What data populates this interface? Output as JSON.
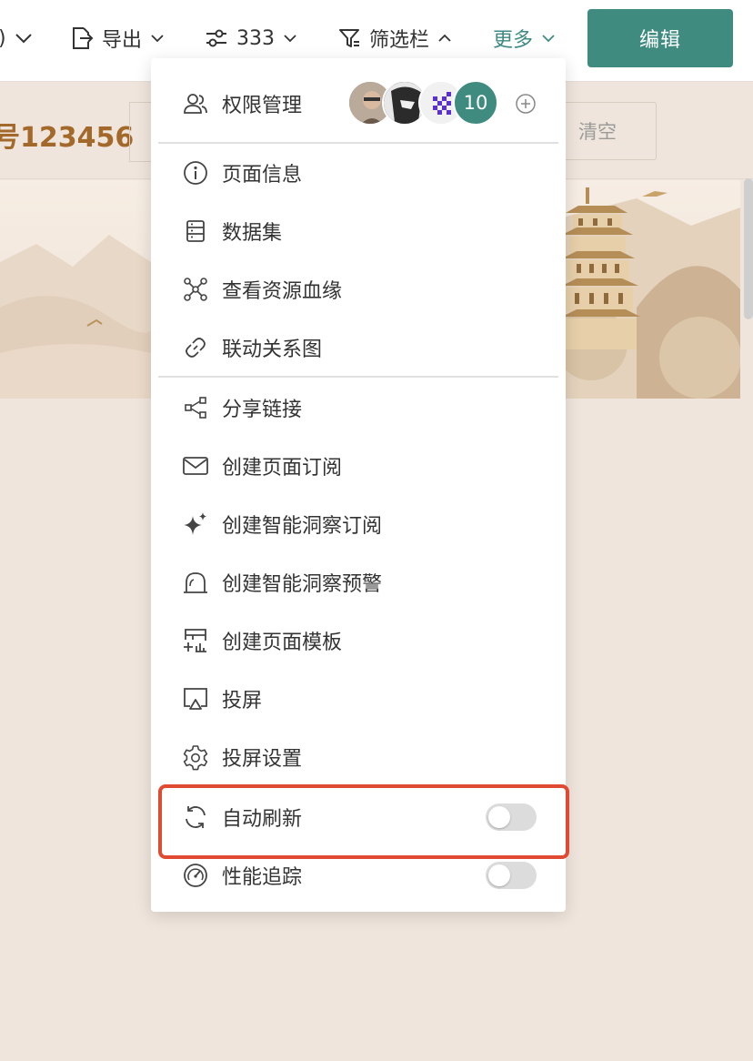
{
  "toolbar": {
    "partial_label": ")",
    "export_label": "导出",
    "params_label": "333",
    "filter_label": "筛选栏",
    "more_label": "更多",
    "edit_label": "编辑"
  },
  "page": {
    "title": "号123456",
    "clear_label": "清空"
  },
  "menu": {
    "permission": {
      "label": "权限管理",
      "avatar_count": "10"
    },
    "items_group1": [
      {
        "label": "页面信息",
        "icon": "info-icon"
      },
      {
        "label": "数据集",
        "icon": "dataset-icon"
      },
      {
        "label": "查看资源血缘",
        "icon": "lineage-icon"
      },
      {
        "label": "联动关系图",
        "icon": "link-icon"
      }
    ],
    "items_group2": [
      {
        "label": "分享链接",
        "icon": "share-icon"
      },
      {
        "label": "创建页面订阅",
        "icon": "mail-icon"
      },
      {
        "label": "创建智能洞察订阅",
        "icon": "sparkle-icon"
      },
      {
        "label": "创建智能洞察预警",
        "icon": "alert-icon"
      },
      {
        "label": "创建页面模板",
        "icon": "template-icon"
      },
      {
        "label": "投屏",
        "icon": "cast-icon"
      },
      {
        "label": "投屏设置",
        "icon": "gear-icon"
      }
    ],
    "toggles": [
      {
        "label": "自动刷新",
        "icon": "refresh-icon",
        "on": false
      },
      {
        "label": "性能追踪",
        "icon": "gauge-icon",
        "on": false
      }
    ]
  },
  "colors": {
    "accent": "#3f8b7f",
    "highlight": "#e04a32",
    "title": "#a3692a",
    "background": "#efe5dc"
  }
}
